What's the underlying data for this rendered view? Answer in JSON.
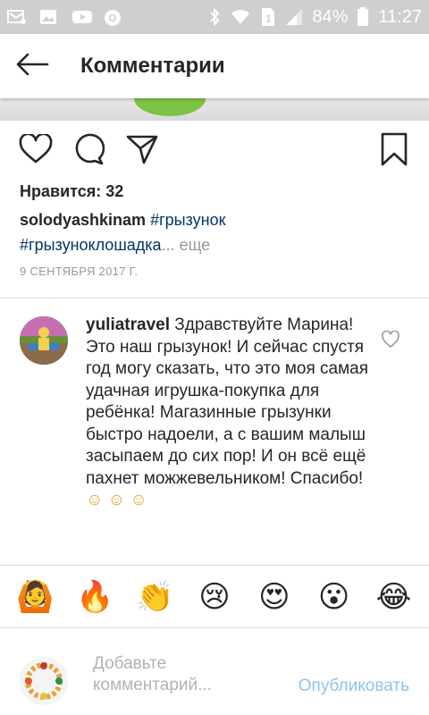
{
  "status_bar": {
    "battery": "84%",
    "time": "11:27"
  },
  "header": {
    "title": "Комментарии"
  },
  "post": {
    "likes": "Нравится: 32",
    "caption": {
      "username": "solodyashkinam",
      "hashtag1": "#грызунок",
      "hashtag2": "#грызуноклошадка",
      "more": "... еще"
    },
    "date": "9 СЕНТЯБРЯ 2017 Г."
  },
  "comment": {
    "username": "yuliatravel",
    "text": " Здравствуйте Марина! Это наш грызунок! И сейчас спустя год могу сказать, что это моя самая удачная игрушка-покупка для ребёнка! Магазинные грызунки быстро надоели, а с вашим малыш засыпаем до сих пор! И он всё ещё пахнет можжевельником! Спасибо!",
    "emojis": "☺ ☺ ☺"
  },
  "emoji_bar": [
    "🙆",
    "🔥",
    "👏",
    "😢",
    "😍",
    "😮",
    "😂"
  ],
  "add_comment": {
    "placeholder": "Добавьте комментарий...",
    "publish_label": "Опубликовать"
  },
  "colors": {
    "status_bar": "#cfcfcf",
    "hashtag": "#003569",
    "muted": "#999999",
    "publish_disabled": "#8bc4ed"
  }
}
